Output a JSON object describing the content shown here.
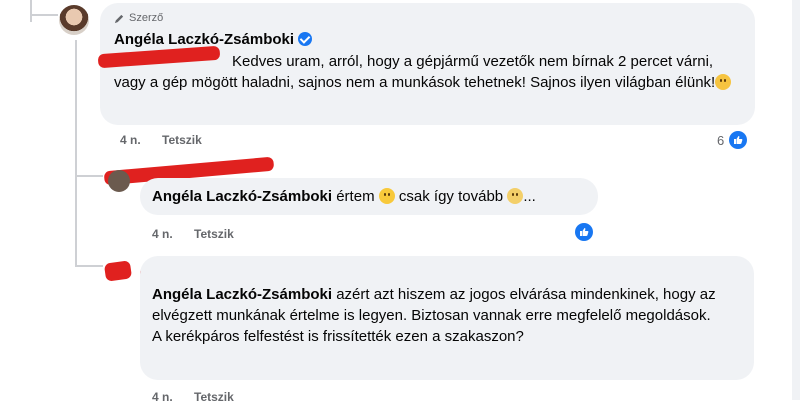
{
  "comment_main": {
    "badge": "Szerző",
    "author": "Angéla Laczkó-Zsámboki",
    "text": "Kedves uram, arról, hogy a gépjármű vezetők nem bírnak 2 percet várni, vagy a gép mögött haladni, sajnos nem a munkások tehetnek! Sajnos ilyen világban élünk!",
    "time": "4 n.",
    "like_label": "Tetszik",
    "reaction_count": "6"
  },
  "reply_1": {
    "author": "Angéla Laczkó-Zsámboki",
    "text_a": "értem",
    "text_b": "csak így tovább",
    "text_c": "...",
    "time": "4 n.",
    "like_label": "Tetszik"
  },
  "reply_2": {
    "author": "Angéla Laczkó-Zsámboki",
    "text": "azért azt hiszem az jogos elvárása mindenkinek, hogy az elvégzett munkának értelme is legyen. Biztosan vannak erre megfelelő megoldások.",
    "text_2": "A kerékpáros felfestést is frissítették ezen a szakaszon?",
    "time": "4 n.",
    "like_label": "Tetszik"
  },
  "icons": [
    "pencil-icon",
    "verified-icon",
    "sad-emoji-icon",
    "smile-emoji-icon",
    "wink-emoji-icon",
    "like-icon"
  ],
  "colors": {
    "accent": "#1877f2",
    "bubble": "#f0f2f5",
    "redaction": "#e0211f",
    "meta": "#65676b"
  }
}
